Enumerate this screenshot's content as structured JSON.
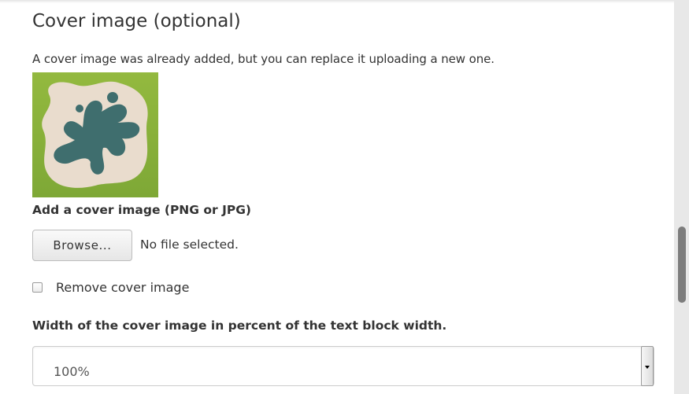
{
  "cover_section": {
    "title": "Cover image (optional)",
    "info_text": "A cover image was already added, but you can replace it uploading a new one.",
    "thumbnail": {
      "icon": "abstract-cover-image",
      "colors": {
        "background": "#8cb33a",
        "cream_shape": "#e9dccd",
        "teal_shape": "#3f6e6e"
      }
    },
    "upload": {
      "label": "Add a cover image (PNG or JPG)",
      "browse_label": "Browse...",
      "file_status": "No file selected."
    },
    "remove": {
      "label": "Remove cover image",
      "checked": false
    },
    "width": {
      "label": "Width of the cover image in percent of the text block width.",
      "selected": "100%"
    }
  }
}
